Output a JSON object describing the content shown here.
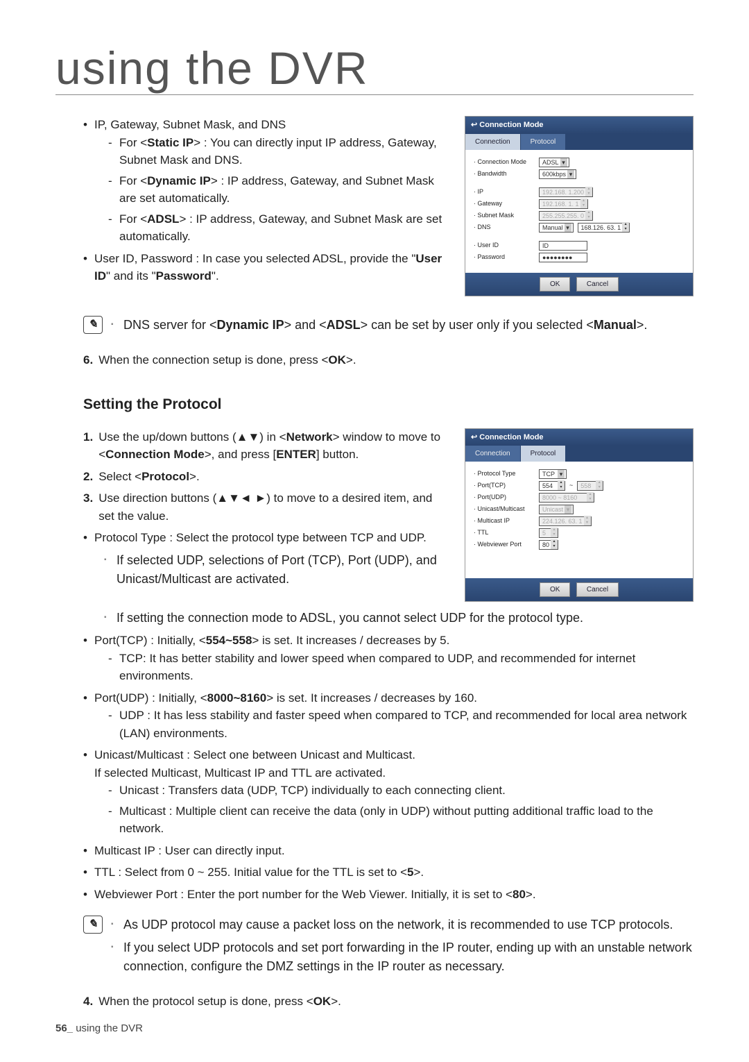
{
  "page": {
    "title": "using the DVR",
    "footer_num": "56_",
    "footer_text": " using the DVR"
  },
  "top": {
    "b1_lead": "IP, Gateway, Subnet Mask, and DNS",
    "d1_a": "For <",
    "d1_b": "Static IP",
    "d1_c": "> : You can directly input IP address, Gateway, Subnet Mask and DNS.",
    "d2_a": "For <",
    "d2_b": "Dynamic IP",
    "d2_c": "> : IP address, Gateway, and Subnet Mask are set automatically.",
    "d3_a": "For <",
    "d3_b": "ADSL",
    "d3_c": "> : IP address, Gateway, and Subnet Mask are set automatically.",
    "b2_a": "User ID, Password : In case you selected ADSL, provide the \"",
    "b2_b": "User ID",
    "b2_c": "\" and its \"",
    "b2_d": "Password",
    "b2_e": "\".",
    "note_a": "DNS server for <",
    "note_b": "Dynamic IP",
    "note_c": "> and <",
    "note_d": "ADSL",
    "note_e": "> can be set by user only if you selected <",
    "note_f": "Manual",
    "note_g": ">.",
    "step6_n": "6.",
    "step6_a": "When the connection setup is done, press <",
    "step6_b": "OK",
    "step6_c": ">."
  },
  "sec2": {
    "heading": "Setting the Protocol",
    "s1_n": "1.",
    "s1_a": "Use the up/down buttons (▲▼) in <",
    "s1_b": "Network",
    "s1_c": "> window to move to <",
    "s1_d": "Connection Mode",
    "s1_e": ">, and press [",
    "s1_f": "ENTER",
    "s1_g": "] button.",
    "s2_n": "2.",
    "s2_a": "Select <",
    "s2_b": "Protocol",
    "s2_c": ">.",
    "s3_n": "3.",
    "s3": "Use direction buttons (▲▼◄ ►) to move to a desired item, and set the value.",
    "b_pt": "Protocol Type : Select the protocol type between TCP and UDP.",
    "pt_note": "If selected UDP, selections of Port (TCP), Port (UDP), and Unicast/Multicast are activated.",
    "pt_note2": "If setting the connection mode to ADSL, you cannot select UDP for the protocol type.",
    "b_tcp_a": "Port(TCP) : Initially, <",
    "b_tcp_b": "554~558",
    "b_tcp_c": "> is set. It increases / decreases by 5.",
    "d_tcp": "TCP: It has better stability and lower speed when compared to UDP, and recommended for internet environments.",
    "b_udp_a": "Port(UDP) : Initially, <",
    "b_udp_b": "8000~8160",
    "b_udp_c": "> is set. It increases / decreases by 160.",
    "d_udp": "UDP : It has less stability and faster speed when compared to TCP, and recommended for local area network (LAN) environments.",
    "b_um1": "Unicast/Multicast : Select one between Unicast and Multicast.",
    "b_um2": "If selected Multicast, Multicast IP and TTL are activated.",
    "d_uni": "Unicast : Transfers data (UDP, TCP) individually to each connecting client.",
    "d_multi": "Multicast : Multiple client can receive the data (only in UDP) without putting additional traffic load to the network.",
    "b_mip": "Multicast IP : User can directly input.",
    "b_ttl_a": "TTL : Select from 0 ~ 255. Initial value for the TTL is set to <",
    "b_ttl_b": "5",
    "b_ttl_c": ">.",
    "b_wv_a": "Webviewer Port : Enter the port number for the Web Viewer. Initially, it is set to <",
    "b_wv_b": "80",
    "b_wv_c": ">.",
    "note1": "As UDP protocol may cause a packet loss on the network, it is recommended to use TCP protocols.",
    "note2": "If you select UDP protocols and set port forwarding in the IP router, ending up with an unstable network connection, configure the DMZ settings in the IP router as necessary.",
    "s4_n": "4.",
    "s4_a": "When the protocol setup is done, press <",
    "s4_b": "OK",
    "s4_c": ">."
  },
  "panel1": {
    "title": "Connection Mode",
    "tab1": "Connection",
    "tab2": "Protocol",
    "rows": {
      "cm_l": "Connection Mode",
      "cm_v": "ADSL",
      "bw_l": "Bandwidth",
      "bw_v": "600kbps",
      "ip_l": "IP",
      "ip_v": "192.168.   1.200",
      "gw_l": "Gateway",
      "gw_v": "192.168.   1.   1",
      "sm_l": "Subnet Mask",
      "sm_v": "255.255.255.   0",
      "dns_l": "DNS",
      "dns_mode": "Manual",
      "dns_v": "168.126.  63.   1",
      "uid_l": "User ID",
      "uid_v": "ID",
      "pw_l": "Password",
      "pw_v": "●●●●●●●●"
    },
    "ok": "OK",
    "cancel": "Cancel"
  },
  "panel2": {
    "title": "Connection Mode",
    "tab1": "Connection",
    "tab2": "Protocol",
    "rows": {
      "pt_l": "Protocol Type",
      "pt_v": "TCP",
      "ptcp_l": "Port(TCP)",
      "ptcp_a": "554",
      "ptcp_sep": "~",
      "ptcp_b": "558",
      "pudp_l": "Port(UDP)",
      "pudp_v": "8000 ~ 8160",
      "um_l": "Unicast/Multicast",
      "um_v": "Unicast",
      "mip_l": "Multicast IP",
      "mip_v": "224.126.  63.   1",
      "ttl_l": "TTL",
      "ttl_v": "5",
      "wv_l": "Webviewer Port",
      "wv_v": "80"
    },
    "ok": "OK",
    "cancel": "Cancel"
  }
}
